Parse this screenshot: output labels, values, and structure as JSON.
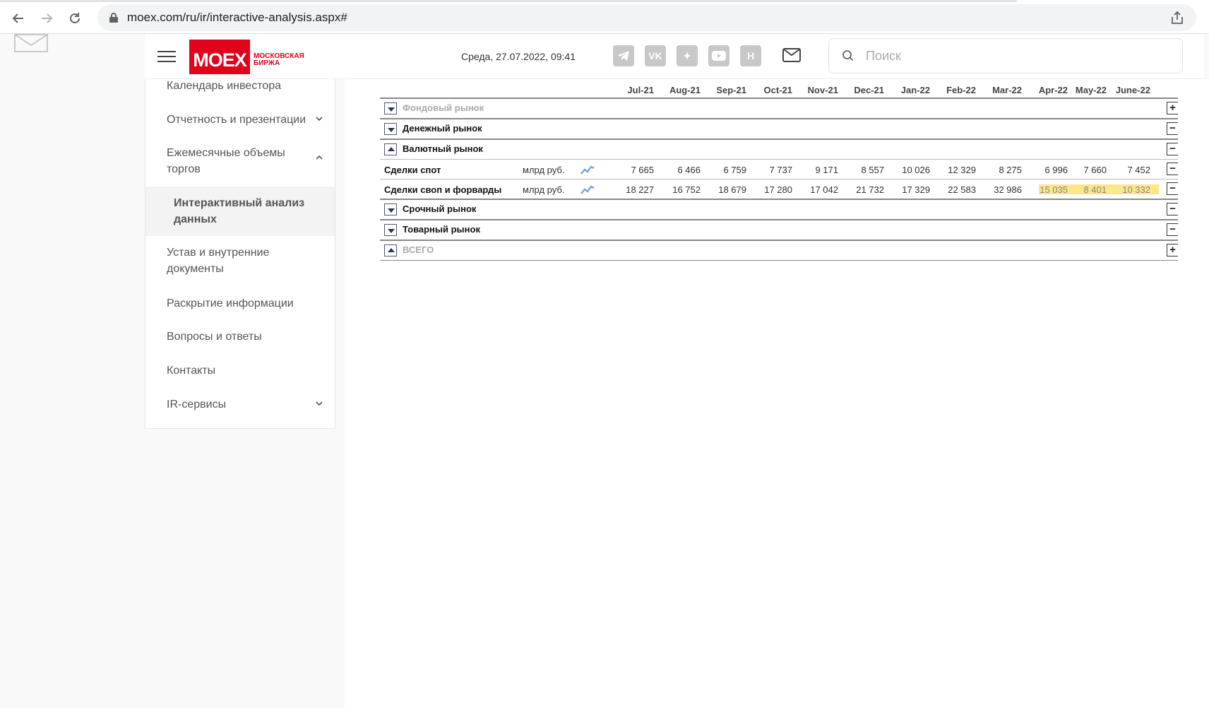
{
  "browser": {
    "url": "moex.com/ru/ir/interactive-analysis.aspx#"
  },
  "header": {
    "logo_text": "MOEX",
    "logo_sub_line1": "МОСКОВСКАЯ",
    "logo_sub_line2": "БИРЖА",
    "date": "Среда, 27.07.2022, 09:41",
    "social": [
      {
        "name": "telegram-icon"
      },
      {
        "name": "vk-icon",
        "text": "VK"
      },
      {
        "name": "zen-icon"
      },
      {
        "name": "youtube-icon"
      },
      {
        "name": "news-icon",
        "text": "H"
      }
    ],
    "search_placeholder": "Поиск"
  },
  "sidebar": {
    "items": [
      {
        "label": "Календарь инвестора"
      },
      {
        "label": "Отчетность и презентации"
      },
      {
        "label": "Ежемесячные объемы торгов"
      },
      {
        "label": "Интерактивный анализ данных"
      },
      {
        "label": "Устав и внутренние документы"
      },
      {
        "label": "Раскрытие информации"
      },
      {
        "label": "Вопросы и ответы"
      },
      {
        "label": "Контакты"
      },
      {
        "label": "IR-сервисы"
      }
    ]
  },
  "table": {
    "months": [
      "Jul-21",
      "Aug-21",
      "Sep-21",
      "Oct-21",
      "Nov-21",
      "Dec-21",
      "Jan-22",
      "Feb-22",
      "Mar-22",
      "Apr-22",
      "May-22",
      "June-22"
    ],
    "sections": {
      "stock": {
        "label": "Фондовый рынок",
        "toggle": "+"
      },
      "money": {
        "label": "Денежный рынок",
        "toggle": "−"
      },
      "fx": {
        "label": "Валютный рынок",
        "toggle": "−"
      },
      "deriv": {
        "label": "Срочный рынок",
        "toggle": "−"
      },
      "commod": {
        "label": "Товарный рынок",
        "toggle": "−"
      },
      "total": {
        "label": "ВСЕГО",
        "toggle": "+"
      }
    },
    "rows": [
      {
        "name": "Сделки спот",
        "unit": "млрд руб.",
        "values": [
          "7 665",
          "6 466",
          "6 759",
          "7 737",
          "9 171",
          "8 557",
          "10 026",
          "12 329",
          "8 275",
          "6 996",
          "7 660",
          "7 452"
        ],
        "toggle": "−"
      },
      {
        "name": "Сделки своп и форварды",
        "unit": "млрд руб.",
        "values": [
          "18 227",
          "16 752",
          "18 679",
          "17 280",
          "17 042",
          "21 732",
          "17 329",
          "22 583",
          "32 986",
          "15 035",
          "8 401",
          "10 332"
        ],
        "toggle": "−"
      }
    ],
    "highlight_color": "#fbe68a"
  }
}
